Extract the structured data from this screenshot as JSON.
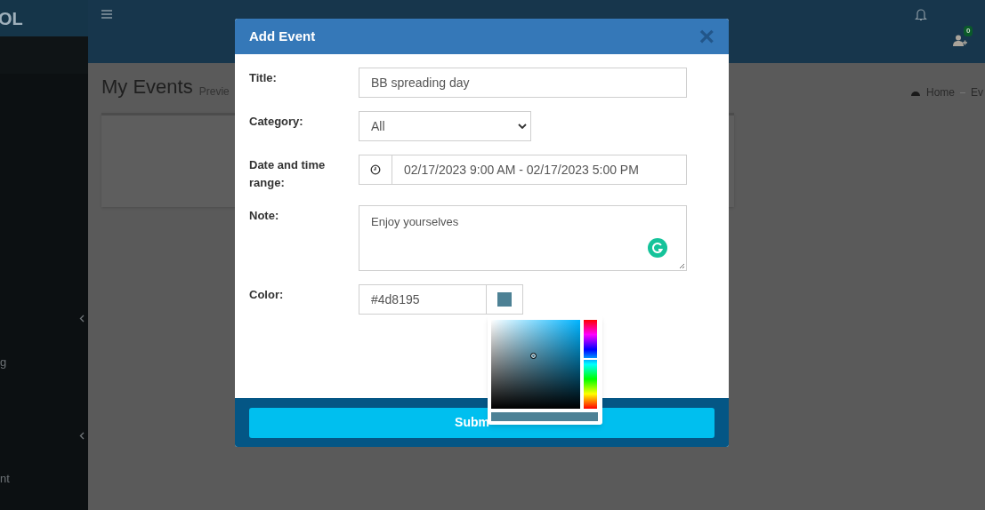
{
  "logo": {
    "text": "OL"
  },
  "header": {
    "notification_badge": "0"
  },
  "sidebar": {
    "items": [
      {
        "label": "g",
        "expandable": true
      },
      {
        "label": "nt",
        "expandable": true
      }
    ]
  },
  "page": {
    "title": "My Events",
    "subtitle": "Previe",
    "breadcrumb": [
      "Home",
      "Ev"
    ]
  },
  "modal": {
    "title": "Add Event",
    "close": "×",
    "fields": [
      {
        "kind": "text",
        "label": "Title:",
        "value": "BB spreading day"
      },
      {
        "kind": "select",
        "label": "Category:",
        "value": "All"
      },
      {
        "kind": "daterange",
        "label": "Date and time range:",
        "value": "02/17/2023 9:00 AM - 02/17/2023 5:00 PM"
      },
      {
        "kind": "textarea",
        "label": "Note:",
        "value": "Enjoy yourselves"
      },
      {
        "kind": "color",
        "label": "Color:",
        "value": "#4d8195",
        "picker_open": true
      }
    ],
    "submit": "Subm"
  }
}
